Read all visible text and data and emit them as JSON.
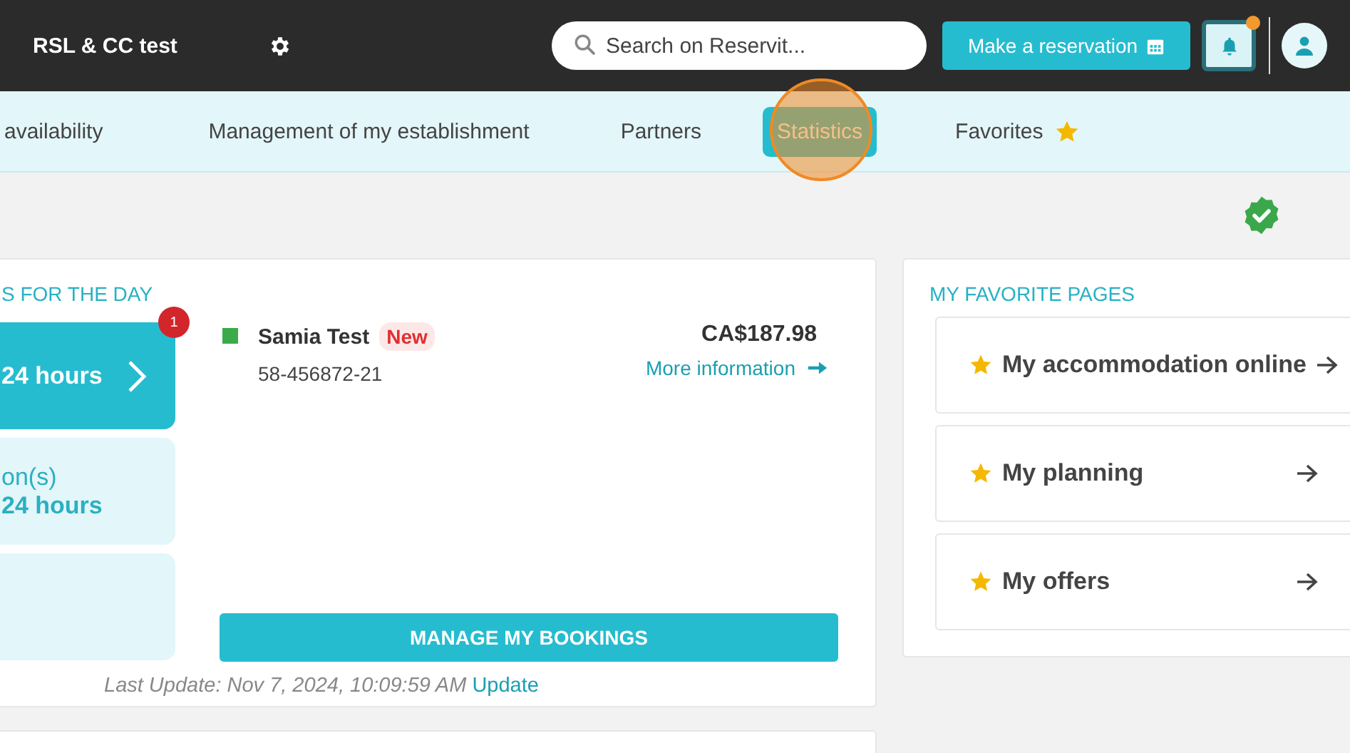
{
  "header": {
    "title": "RSL & CC test",
    "search": {
      "placeholder": "Search on Reservit..."
    },
    "reserve_button": "Make a reservation",
    "notifications": {
      "unread": true
    }
  },
  "nav": [
    {
      "label": "availability",
      "selected": false,
      "star": false
    },
    {
      "label": "Management of my establishment",
      "selected": false,
      "star": false
    },
    {
      "label": "Partners",
      "selected": false,
      "star": false
    },
    {
      "label": "Statistics",
      "selected": true,
      "star": false
    },
    {
      "label": "Favorites",
      "selected": false,
      "star": true
    }
  ],
  "click_highlight": true,
  "status": {
    "verified": true
  },
  "day_panel": {
    "title": "S FOR THE DAY",
    "tiles": [
      {
        "kind": "active",
        "lines": [
          "24 hours"
        ],
        "badge": "1"
      },
      {
        "kind": "plain",
        "lines": [
          "on(s)",
          "24 hours"
        ]
      },
      {
        "kind": "plain"
      }
    ],
    "bookings": [
      {
        "name": "Samia Test",
        "tag": "New",
        "reference": "58-456872-21",
        "amount": "CA$187.98",
        "link": "More information",
        "color": "#3aaa4a"
      }
    ],
    "manage_button": "MANAGE MY BOOKINGS",
    "last_update": "Last Update: Nov 7, 2024, 10:09:59 AM",
    "update_link": "Update"
  },
  "favorites": {
    "title": "MY FAVORITE PAGES",
    "items": [
      {
        "label": "My accommodation online"
      },
      {
        "label": "My planning"
      },
      {
        "label": "My offers"
      }
    ]
  }
}
